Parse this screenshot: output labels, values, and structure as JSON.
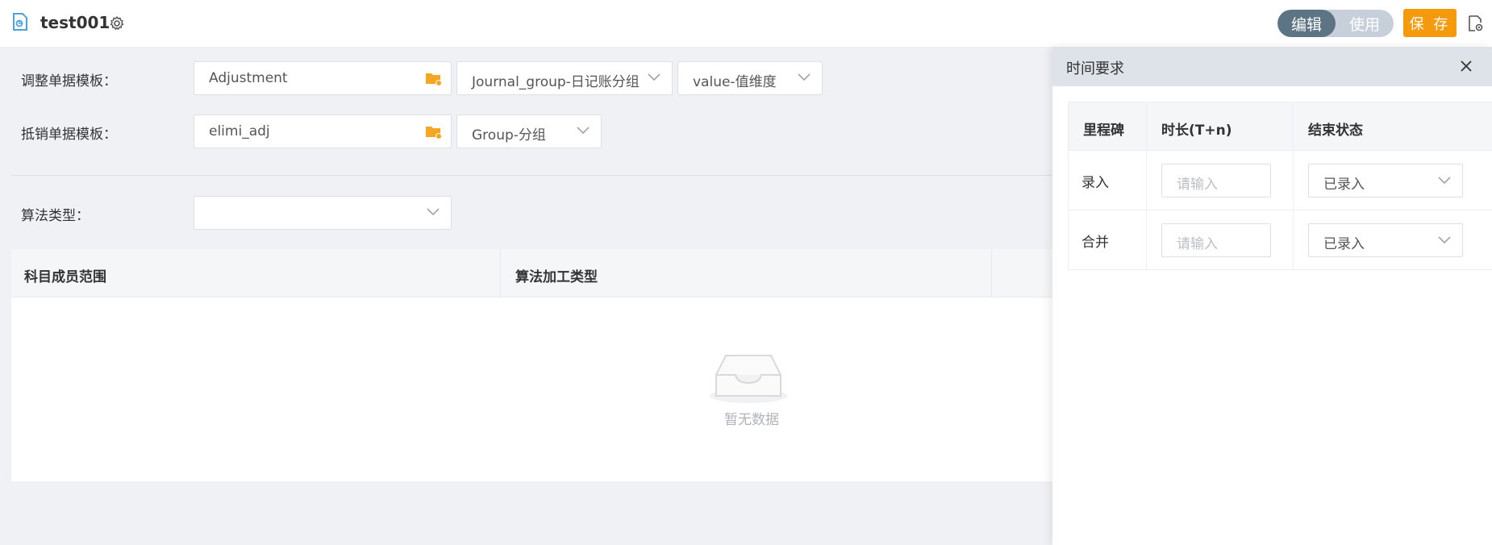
{
  "header": {
    "title": "test001",
    "toggle": {
      "edit_label": "编辑",
      "use_label": "使用"
    },
    "save_label": "保 存",
    "colors": {
      "accent": "#f59a0c",
      "toggle_active": "#5d7485"
    }
  },
  "form": {
    "adjustment_template": {
      "label": "调整单据模板：",
      "value": "Adjustment",
      "dim1": "Journal_group-日记账分组",
      "dim2": "value-值维度"
    },
    "elimination_template": {
      "label": "抵销单据模板：",
      "value": "elimi_adj",
      "dim1": "Group-分组"
    },
    "algorithm_type": {
      "label": "算法类型："
    }
  },
  "table": {
    "columns": [
      "科目成员范围",
      "算法加工类型"
    ],
    "empty_text": "暂无数据"
  },
  "panel": {
    "title": "时间要求",
    "columns": [
      "里程碑",
      "时长(T+n)",
      "结束状态"
    ],
    "rows": [
      {
        "milestone": "录入",
        "duration_placeholder": "请输入",
        "status": "已录入"
      },
      {
        "milestone": "合并",
        "duration_placeholder": "请输入",
        "status": "已录入"
      }
    ]
  },
  "icons": [
    "document-icon",
    "gear-icon",
    "folder-icon",
    "chevron-down-icon",
    "empty-box-icon",
    "close-icon",
    "settings-doc-icon"
  ]
}
